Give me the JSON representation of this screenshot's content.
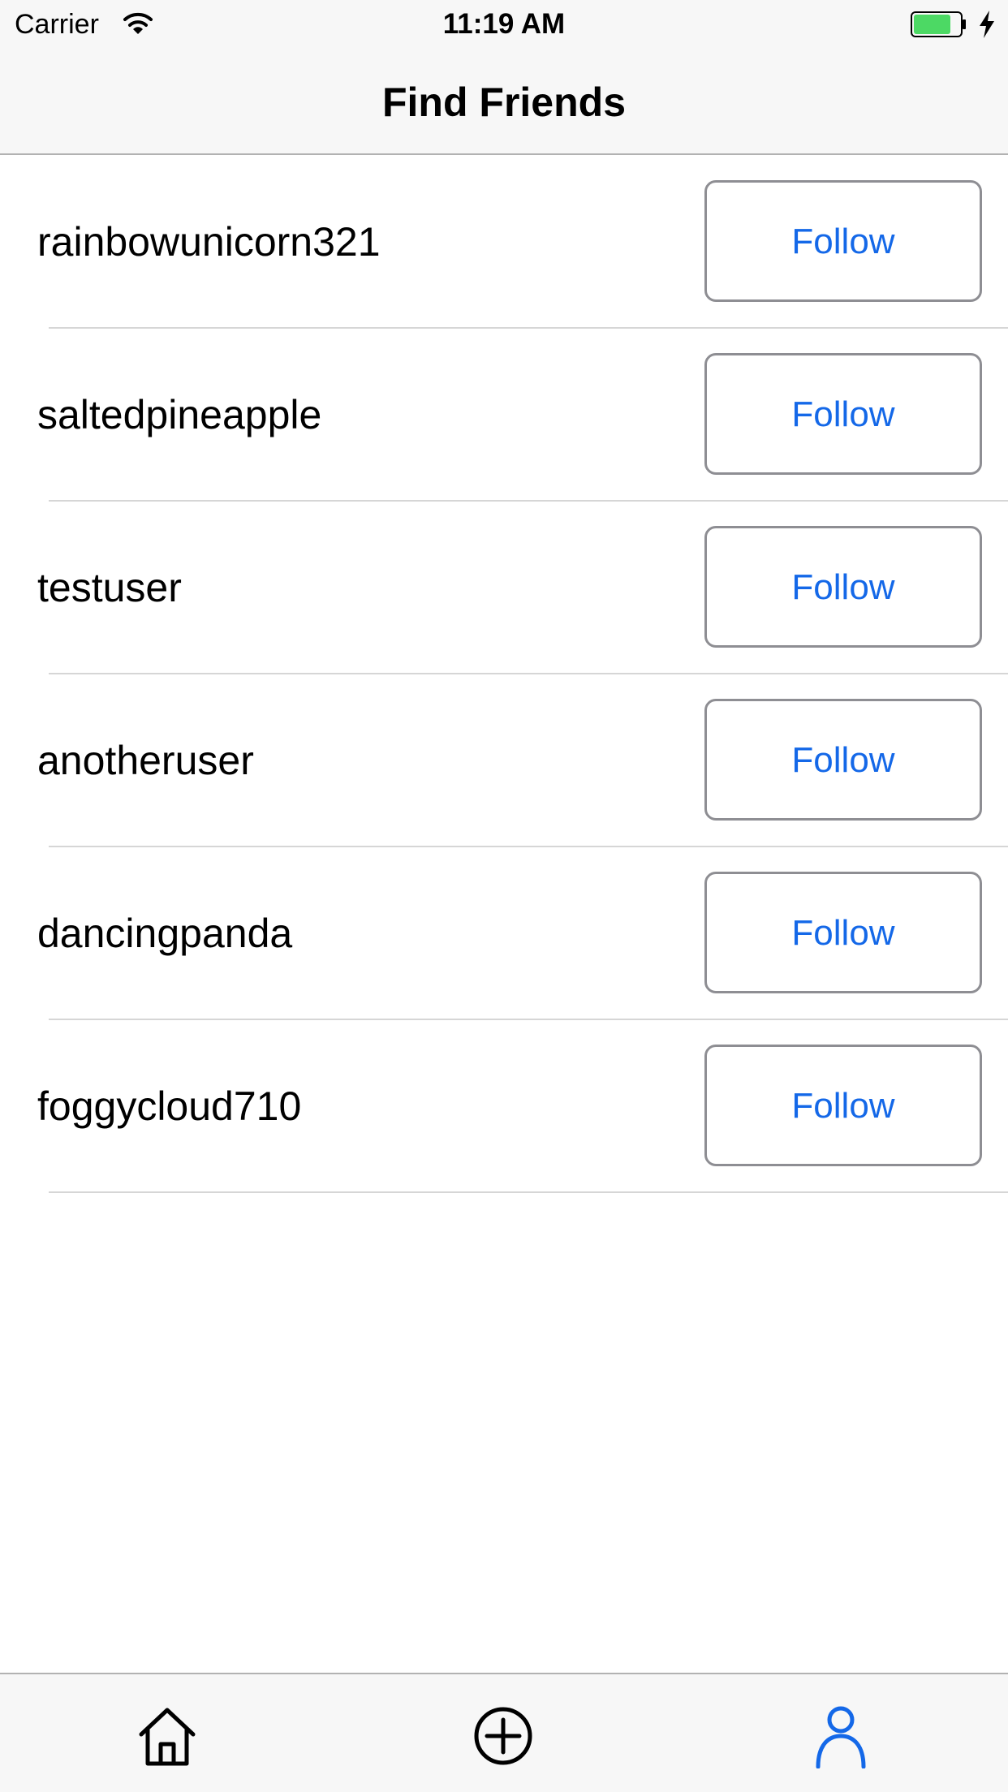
{
  "status_bar": {
    "carrier": "Carrier",
    "time": "11:19 AM",
    "icons": [
      "wifi-icon",
      "battery-icon",
      "charging-bolt-icon"
    ],
    "battery_color": "#4cd964"
  },
  "nav": {
    "title": "Find Friends"
  },
  "users": [
    {
      "username": "rainbowunicorn321",
      "action": "Follow"
    },
    {
      "username": "saltedpineapple",
      "action": "Follow"
    },
    {
      "username": "testuser",
      "action": "Follow"
    },
    {
      "username": "anotheruser",
      "action": "Follow"
    },
    {
      "username": "dancingpanda",
      "action": "Follow"
    },
    {
      "username": "foggycloud710",
      "action": "Follow"
    }
  ],
  "tab_bar": {
    "tabs": [
      {
        "icon": "home-icon",
        "selected": false
      },
      {
        "icon": "add-circle-icon",
        "selected": false
      },
      {
        "icon": "profile-icon",
        "selected": true
      }
    ]
  },
  "colors": {
    "accent": "#1468e8",
    "bar_background": "#f7f7f7",
    "separator": "#d6d6d6"
  }
}
